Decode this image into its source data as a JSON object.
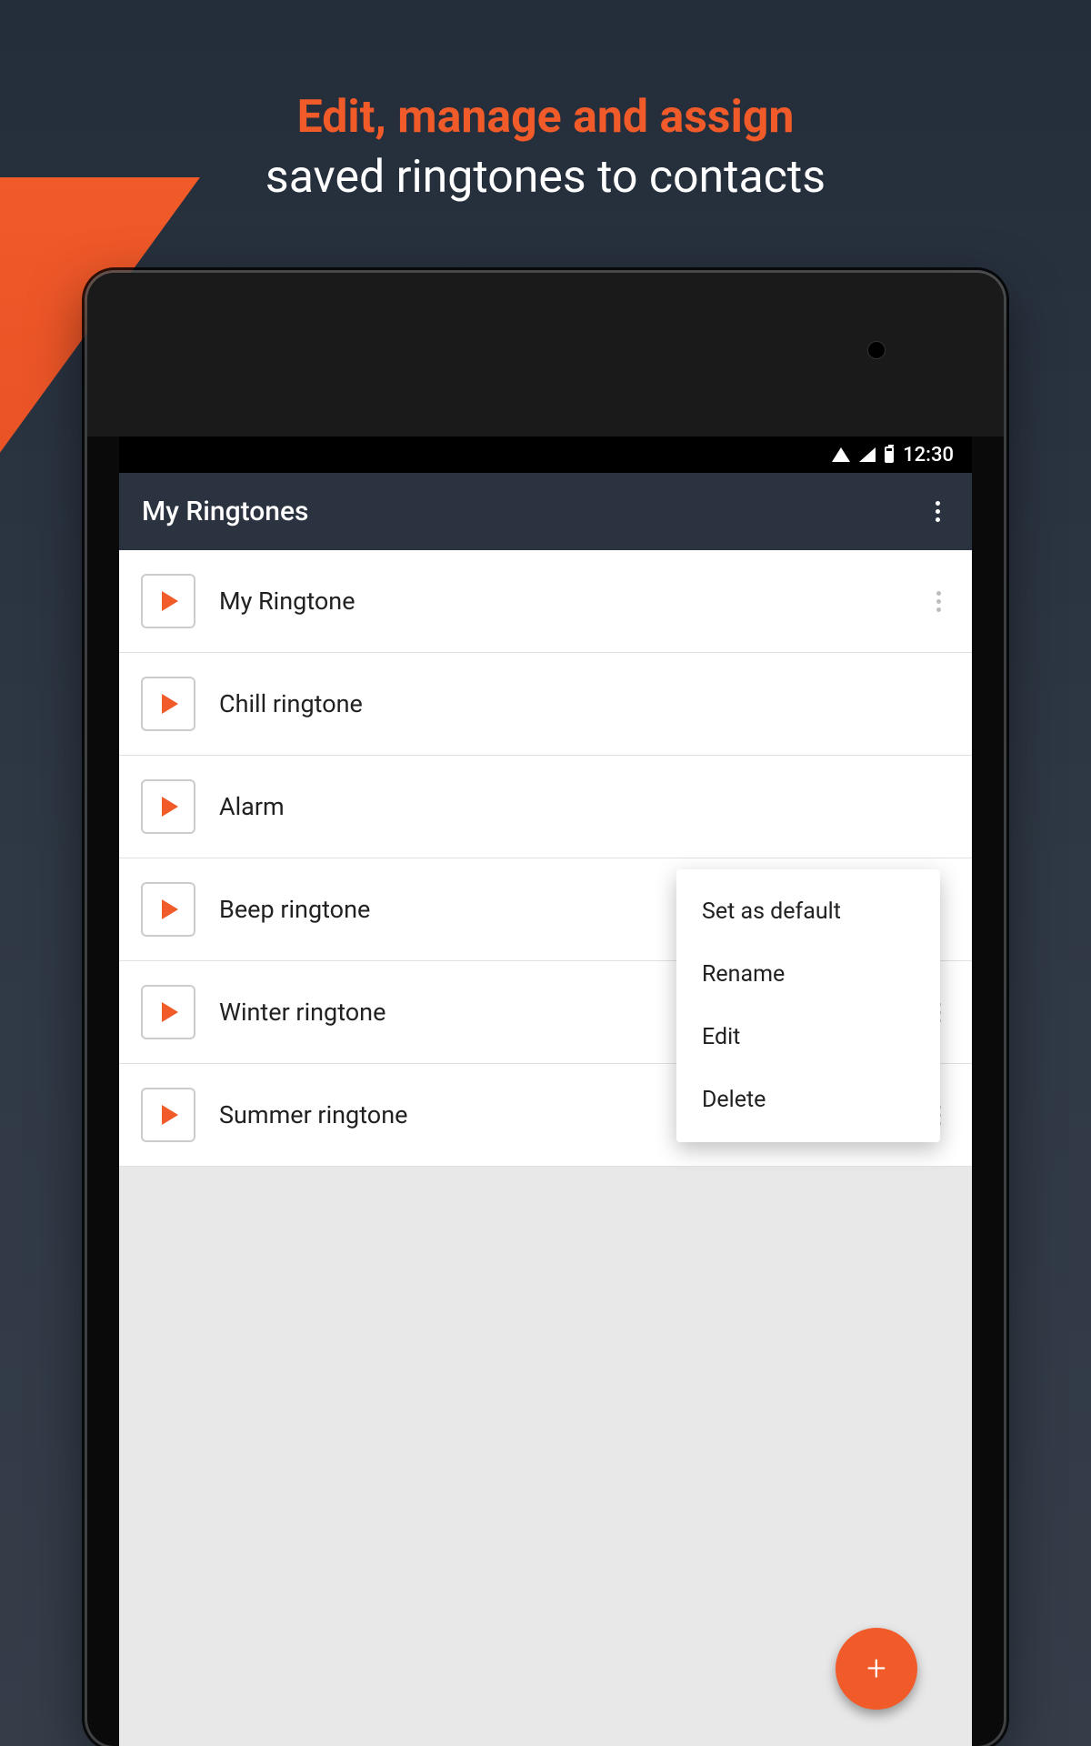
{
  "promo": {
    "headline_bold": "Edit, manage and assign",
    "headline_normal": "saved ringtones to contacts"
  },
  "status_bar": {
    "time": "12:30"
  },
  "toolbar": {
    "title": "My Ringtones"
  },
  "ringtones": [
    {
      "label": "My Ringtone"
    },
    {
      "label": "Chill ringtone"
    },
    {
      "label": "Alarm"
    },
    {
      "label": "Beep ringtone"
    },
    {
      "label": "Winter ringtone"
    },
    {
      "label": "Summer ringtone"
    }
  ],
  "context_menu": {
    "items": [
      "Set as default",
      "Rename",
      "Edit",
      "Delete"
    ]
  },
  "fab": {
    "icon": "+"
  }
}
